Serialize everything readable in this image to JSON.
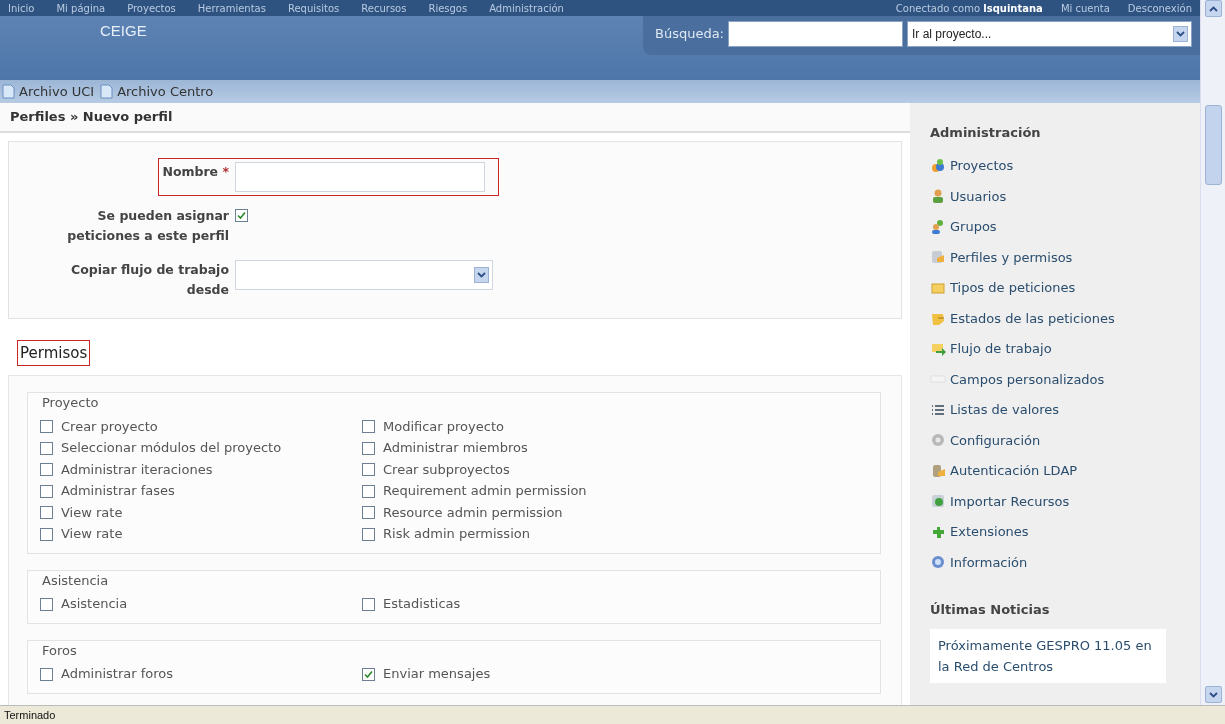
{
  "top_menu": [
    {
      "label": "Inicio"
    },
    {
      "label": "Mi página"
    },
    {
      "label": "Proyectos"
    },
    {
      "label": "Herramientas"
    },
    {
      "label": "Requisitos"
    },
    {
      "label": "Recursos"
    },
    {
      "label": "Riesgos"
    },
    {
      "label": "Administración"
    }
  ],
  "account": {
    "logged_in_prefix": "Conectado como",
    "user": "lsquintana",
    "links": [
      "Mi cuenta",
      "Desconexión"
    ]
  },
  "header": {
    "title": "CEIGE",
    "search_label": "Búsqueda:",
    "project_select": "Ir al proyecto..."
  },
  "file_links": [
    "Archivo UCI",
    "Archivo Centro"
  ],
  "breadcrumb": {
    "parent": "Perfiles",
    "separator": "»",
    "current": "Nuevo perfil"
  },
  "form": {
    "fields": [
      {
        "kind": "text",
        "label": "Nombre",
        "required_mark": "*",
        "highlighted": true
      },
      {
        "kind": "checkbox",
        "label": "Se pueden asignar peticiones a este perfil",
        "checked": true
      },
      {
        "kind": "select",
        "label": "Copiar flujo de trabajo desde"
      }
    ]
  },
  "permissions": {
    "title": "Permisos",
    "highlighted": true,
    "groups": [
      {
        "title": "Proyecto",
        "items": [
          {
            "label": "Crear proyecto",
            "checked": false
          },
          {
            "label": "Modificar proyecto",
            "checked": false
          },
          {
            "label": "Seleccionar módulos del proyecto",
            "checked": false
          },
          {
            "label": "Administrar miembros",
            "checked": false
          },
          {
            "label": "Administrar iteraciones",
            "checked": false
          },
          {
            "label": "Crear subproyectos",
            "checked": false
          },
          {
            "label": "Administrar fases",
            "checked": false
          },
          {
            "label": "Requirement admin permission",
            "checked": false
          },
          {
            "label": "View rate",
            "checked": false
          },
          {
            "label": "Resource admin permission",
            "checked": false
          },
          {
            "label": "View rate",
            "checked": false
          },
          {
            "label": "Risk admin permission",
            "checked": false
          }
        ]
      },
      {
        "title": "Asistencia",
        "items": [
          {
            "label": "Asistencia",
            "checked": false
          },
          {
            "label": "Estadisticas",
            "checked": false
          }
        ]
      },
      {
        "title": "Foros",
        "items": [
          {
            "label": "Administrar foros",
            "checked": false
          },
          {
            "label": "Enviar mensajes",
            "checked": true
          }
        ]
      }
    ]
  },
  "sidebar": {
    "title": "Administración",
    "items": [
      {
        "label": "Proyectos"
      },
      {
        "label": "Usuarios"
      },
      {
        "label": "Grupos"
      },
      {
        "label": "Perfiles y permisos"
      },
      {
        "label": "Tipos de peticiones"
      },
      {
        "label": "Estados de las peticiones"
      },
      {
        "label": "Flujo de trabajo"
      },
      {
        "label": "Campos personalizados"
      },
      {
        "label": "Listas de valores"
      },
      {
        "label": "Configuración"
      },
      {
        "label": "Autenticación LDAP"
      },
      {
        "label": "Importar Recursos"
      },
      {
        "label": "Extensiones"
      },
      {
        "label": "Información"
      }
    ],
    "news_title": "Últimas Noticias",
    "news": [
      "Próximamente GESPRO 11.05 en la Red de Centros"
    ]
  },
  "status_bar": "Terminado"
}
